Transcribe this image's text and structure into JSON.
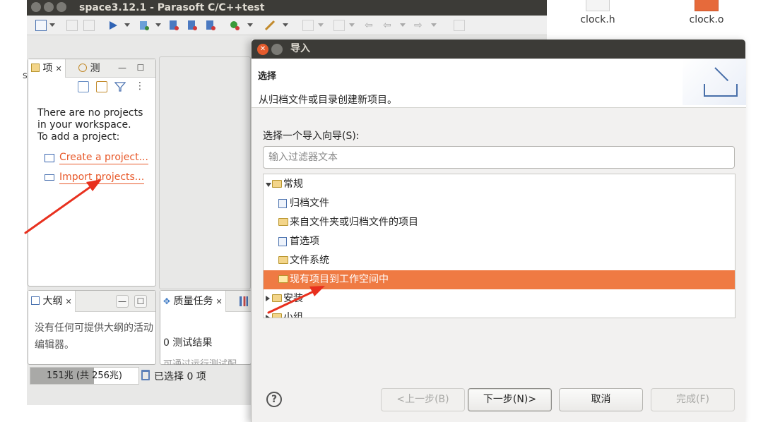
{
  "desktop": {
    "files": [
      {
        "name": "clock.h",
        "icon": "text-file-icon"
      },
      {
        "name": "clock.o",
        "icon": "object-file-icon"
      }
    ]
  },
  "ide": {
    "title": "space3.12.1 - Parasoft C/C++test",
    "side_char": "s",
    "project_panel": {
      "tab_project": "项",
      "tab_test": "测",
      "empty_message_line1": "There are no projects",
      "empty_message_line2": "in your workspace.",
      "empty_message_line3": "To add a project:",
      "create_link": "Create a project...",
      "import_link": "Import projects..."
    },
    "outline_panel": {
      "tab": "大纲",
      "message": "没有任何可提供大纲的活动编辑器。"
    },
    "quality_panel": {
      "tab": "质量任务",
      "result": "0 测试结果",
      "hint": "可通过运行测试配"
    },
    "status": {
      "heap": "151兆 (共 256兆)",
      "heap_used_fraction": 0.59,
      "selected": "已选择 0 项"
    }
  },
  "dialog": {
    "title": "导入",
    "section": "选择",
    "description": "从归档文件或目录创建新项目。",
    "wizard_label": "选择一个导入向导(S):",
    "filter_placeholder": "输入过滤器文本",
    "tree": [
      {
        "label": "常规",
        "expanded": true,
        "icon": "folder-icon"
      },
      {
        "label": "归档文件",
        "icon": "archive-file-icon"
      },
      {
        "label": "来自文件夹或归档文件的项目",
        "icon": "folder-icon"
      },
      {
        "label": "首选项",
        "icon": "preferences-icon"
      },
      {
        "label": "文件系统",
        "icon": "folder-icon"
      },
      {
        "label": "现有项目到工作空间中",
        "icon": "project-folder-icon",
        "selected": true
      },
      {
        "label": "安装",
        "expanded": false,
        "icon": "folder-icon"
      },
      {
        "label": "小组",
        "expanded": false,
        "icon": "folder-icon"
      }
    ],
    "buttons": {
      "help": "?",
      "back": "<上一步(B)",
      "next": "下一步(N)>",
      "cancel": "取消",
      "finish": "完成(F)"
    },
    "selection_color": "#ef7a43"
  }
}
